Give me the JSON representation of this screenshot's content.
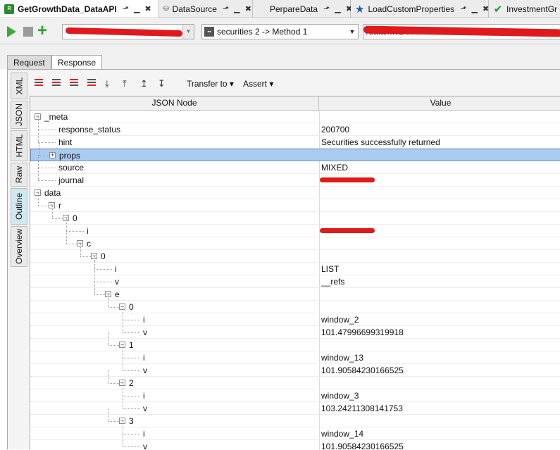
{
  "tabs": [
    {
      "label": "GetGrowthData_DataAPI",
      "icon": "rest-icon",
      "active": true
    },
    {
      "label": "DataSource",
      "icon": "database-icon",
      "active": false
    },
    {
      "label": "PerpareData",
      "icon": "grid-icon",
      "active": false
    },
    {
      "label": "LoadCustomProperties",
      "icon": "star-icon",
      "active": false
    },
    {
      "label": "InvestmentGr",
      "icon": "check-icon",
      "active": false
    }
  ],
  "tab_controls": "⬏ ▁ ✖",
  "request": {
    "method_label": "securities 2 -> Method 1",
    "url_fragment": "/data/...v2/securiti...&"
  },
  "panel_tabs": {
    "request": "Request",
    "response": "Response",
    "active": "Response"
  },
  "side_tabs": [
    "XML",
    "JSON",
    "HTML",
    "Raw",
    "Outline",
    "Overview"
  ],
  "side_tab_active": "Outline",
  "toolbar": {
    "transfer_to": "Transfer to",
    "assert": "Assert"
  },
  "tree": {
    "col_node": "JSON Node",
    "col_value": "Value",
    "rows": [
      {
        "node": "_meta",
        "value": "",
        "depth": 0,
        "expander": "minus"
      },
      {
        "node": "response_status",
        "value": "200700",
        "depth": 1,
        "expander": ""
      },
      {
        "node": "hint",
        "value": "Securities successfully returned",
        "depth": 1,
        "expander": ""
      },
      {
        "node": "props",
        "value": "",
        "depth": 1,
        "expander": "plus",
        "selected": true
      },
      {
        "node": "source",
        "value": "MIXED",
        "depth": 1,
        "expander": ""
      },
      {
        "node": "journal",
        "value": "",
        "depth": 1,
        "expander": "",
        "redacted": true
      },
      {
        "node": "data",
        "value": "",
        "depth": 0,
        "expander": "minus"
      },
      {
        "node": "r",
        "value": "",
        "depth": 1,
        "expander": "minus"
      },
      {
        "node": "0",
        "value": "",
        "depth": 2,
        "expander": "minus"
      },
      {
        "node": "i",
        "value": "",
        "depth": 3,
        "expander": "",
        "redacted": true
      },
      {
        "node": "c",
        "value": "",
        "depth": 3,
        "expander": "minus"
      },
      {
        "node": "0",
        "value": "",
        "depth": 4,
        "expander": "minus"
      },
      {
        "node": "i",
        "value": "LIST",
        "depth": 5,
        "expander": ""
      },
      {
        "node": "v",
        "value": "__refs",
        "depth": 5,
        "expander": ""
      },
      {
        "node": "e",
        "value": "",
        "depth": 5,
        "expander": "minus"
      },
      {
        "node": "0",
        "value": "",
        "depth": 6,
        "expander": "minus"
      },
      {
        "node": "i",
        "value": "window_2",
        "depth": 7,
        "expander": ""
      },
      {
        "node": "v",
        "value": "101.47996699319918",
        "depth": 7,
        "expander": ""
      },
      {
        "node": "1",
        "value": "",
        "depth": 6,
        "expander": "minus"
      },
      {
        "node": "i",
        "value": "window_13",
        "depth": 7,
        "expander": ""
      },
      {
        "node": "v",
        "value": "101.90584230166525",
        "depth": 7,
        "expander": ""
      },
      {
        "node": "2",
        "value": "",
        "depth": 6,
        "expander": "minus"
      },
      {
        "node": "i",
        "value": "window_3",
        "depth": 7,
        "expander": ""
      },
      {
        "node": "v",
        "value": "103.24211308141753",
        "depth": 7,
        "expander": ""
      },
      {
        "node": "3",
        "value": "",
        "depth": 6,
        "expander": "minus"
      },
      {
        "node": "i",
        "value": "window_14",
        "depth": 7,
        "expander": ""
      },
      {
        "node": "v",
        "value": "101.90584230166525",
        "depth": 7,
        "expander": ""
      }
    ]
  },
  "colors": {
    "selection": "#a9ccf2",
    "play": "#3aa83a",
    "redaction": "#e0191c"
  }
}
